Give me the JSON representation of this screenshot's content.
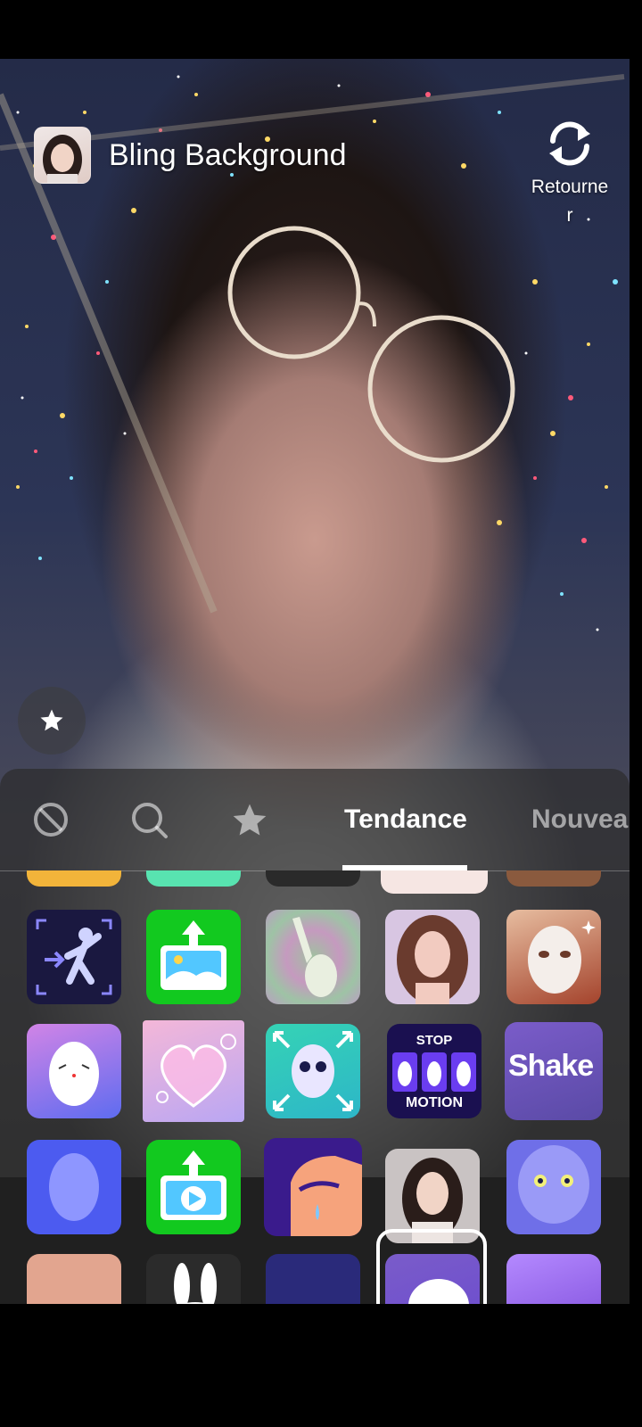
{
  "effect": {
    "title": "Bling Background",
    "thumbnail_icon": "woman-portrait-thumbnail"
  },
  "flip_camera": {
    "label": "Retourner",
    "icon": "rotate-camera-icon"
  },
  "favorite_button": {
    "icon": "star-icon"
  },
  "tabs": {
    "items": [
      {
        "icon": "none-icon"
      },
      {
        "icon": "search-icon"
      },
      {
        "icon": "star-icon"
      },
      {
        "label": "Tendance",
        "active": true
      },
      {
        "label": "Nouvea"
      }
    ]
  },
  "effects_grid": {
    "row2": [
      "dance-motion-effect",
      "upload-photo-effect",
      "hypnotic-wave-effect",
      "beauty-portrait-effect",
      "mask-face-effect"
    ],
    "row3": [
      {
        "icon": "blush-face-effect"
      },
      {
        "icon": "heart-bubble-effect"
      },
      {
        "icon": "stretch-face-effect"
      },
      {
        "icon": "stop-motion-effect",
        "top_text": "STOP",
        "bottom_text": "MOTION"
      },
      {
        "icon": "shake-effect",
        "text": "Shake"
      }
    ],
    "row4": [
      "blank-face-effect",
      "upload-video-effect",
      "crying-face-effect",
      "bling-background-effect",
      "alien-face-effect"
    ],
    "selected_effect": "bling-background-effect"
  },
  "colors": {
    "green": "#12c91f",
    "indigo": "#4c5bf0",
    "selection": "#ffffff"
  }
}
